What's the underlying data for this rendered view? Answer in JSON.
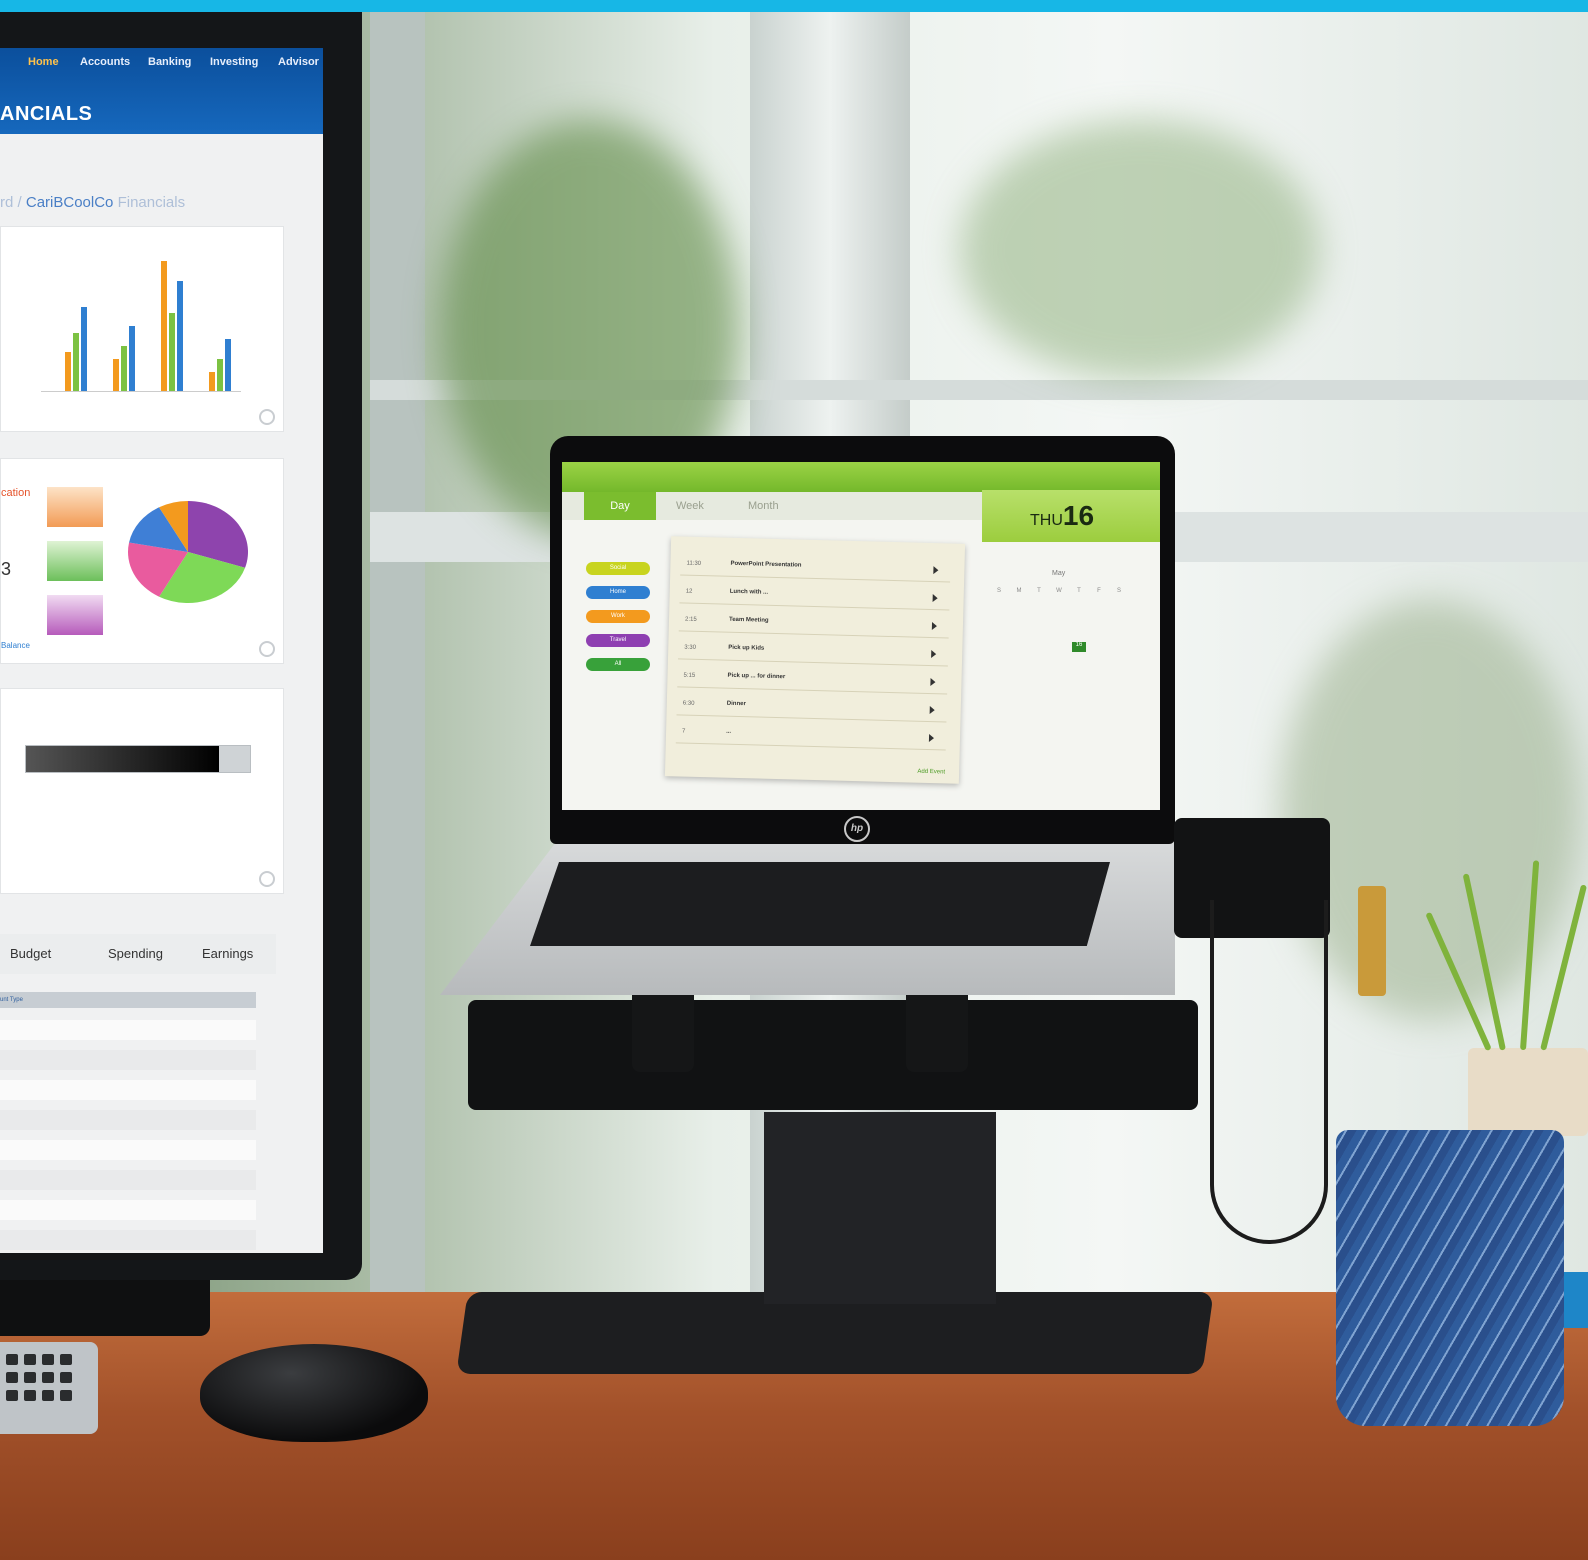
{
  "monitor_app": {
    "nav": [
      "Home",
      "Accounts",
      "Banking",
      "Investing",
      "Advisor"
    ],
    "title": "ANCIALS",
    "breadcrumb_prefix": "rd  /",
    "breadcrumb_link": "CariBCoolCo",
    "breadcrumb_tail": "Financials",
    "allocation_label": "cation",
    "balance_link": "Balance",
    "number_fragment": "3",
    "tabs": [
      "Budget",
      "Spending",
      "Earnings"
    ],
    "table_header": "unt Type",
    "progress_fraction": 0.86,
    "bar_chart": {
      "type": "bar",
      "categories": [
        "",
        "",
        "",
        ""
      ],
      "series": [
        {
          "values": [
            30,
            25,
            100,
            15
          ]
        },
        {
          "values": [
            45,
            35,
            60,
            25
          ]
        },
        {
          "values": [
            65,
            50,
            85,
            40
          ]
        }
      ],
      "colors": [
        "#f39a1e",
        "#7cc242",
        "#2f7fd1"
      ]
    },
    "pie_chart": {
      "type": "pie",
      "colors": [
        "#8e44ad",
        "#7ed957",
        "#e95b9e",
        "#3f7fd6",
        "#f39a1e"
      ]
    }
  },
  "laptop_app": {
    "tabs": [
      "Day",
      "Week",
      "Month"
    ],
    "date_day": "THU",
    "date_num": "16",
    "month_label": "May",
    "categories": [
      {
        "label": "Social",
        "color": "#c8d41f"
      },
      {
        "label": "Home",
        "color": "#2f7fd1"
      },
      {
        "label": "Work",
        "color": "#f39a1e"
      },
      {
        "label": "Travel",
        "color": "#8e3fb1"
      },
      {
        "label": "All",
        "color": "#38a13a"
      }
    ],
    "events": [
      {
        "time": "11:30",
        "name": "PowerPoint Presentation"
      },
      {
        "time": "12",
        "name": "Lunch with ..."
      },
      {
        "time": "2:15",
        "name": "Team Meeting"
      },
      {
        "time": "3:30",
        "name": "Pick up Kids"
      },
      {
        "time": "5:15",
        "name": "Pick up ... for dinner"
      },
      {
        "time": "6:30",
        "name": "Dinner"
      },
      {
        "time": "7",
        "name": "..."
      }
    ],
    "add_event": "Add Event",
    "weekday_letters": [
      "S",
      "M",
      "T",
      "W",
      "T",
      "F",
      "S"
    ],
    "highlight_day": "16"
  },
  "laptop_brand": "hp",
  "colors": {
    "accent_top": "#17b7e6",
    "finance_blue": "#1668bd",
    "calendar_green": "#7bbd2e"
  }
}
